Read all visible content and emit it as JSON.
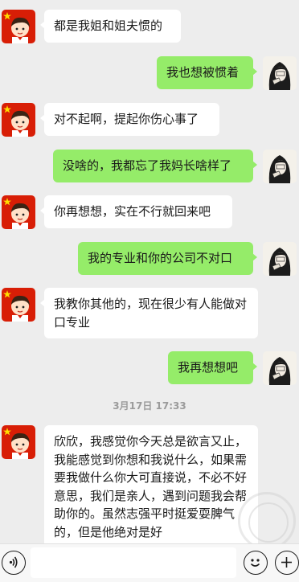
{
  "messages": [
    {
      "side": "left",
      "avatar": "flag-avatar-icon",
      "text": "都是我姐和姐夫惯的"
    },
    {
      "side": "right",
      "avatar": "girl-avatar-icon",
      "text": "我也想被惯着"
    },
    {
      "side": "left",
      "avatar": "flag-avatar-icon",
      "text": "对不起啊，提起你伤心事了"
    },
    {
      "side": "right",
      "avatar": "girl-avatar-icon",
      "text": "没啥的，我都忘了我妈长啥样了"
    },
    {
      "side": "left",
      "avatar": "flag-avatar-icon",
      "text": "你再想想，实在不行就回来吧"
    },
    {
      "side": "right",
      "avatar": "girl-avatar-icon",
      "text": "我的专业和你的公司不对口"
    },
    {
      "side": "left",
      "avatar": "flag-avatar-icon",
      "text": "我教你其他的，现在很少有人能做对口专业"
    },
    {
      "side": "right",
      "avatar": "girl-avatar-icon",
      "text": "我再想想吧"
    },
    {
      "side": "left",
      "avatar": "flag-avatar-icon",
      "text": "欣欣，我感觉你今天总是欲言又止，我能感觉到你想和我说什么，如果需要我做什么你大可直接说，不必不好意思，我们是亲人，遇到问题我会帮助你的。虽然志强平时挺爱耍脾气的，但是他绝对是好"
    }
  ],
  "timestamp": "3月17日 17:33",
  "input": {
    "value": "",
    "placeholder": ""
  },
  "icons": {
    "voice": "voice-icon",
    "emoji": "emoji-icon",
    "more": "plus-icon"
  },
  "colors": {
    "background": "#ededed",
    "sent_bubble": "#95ec69",
    "received_bubble": "#ffffff"
  }
}
